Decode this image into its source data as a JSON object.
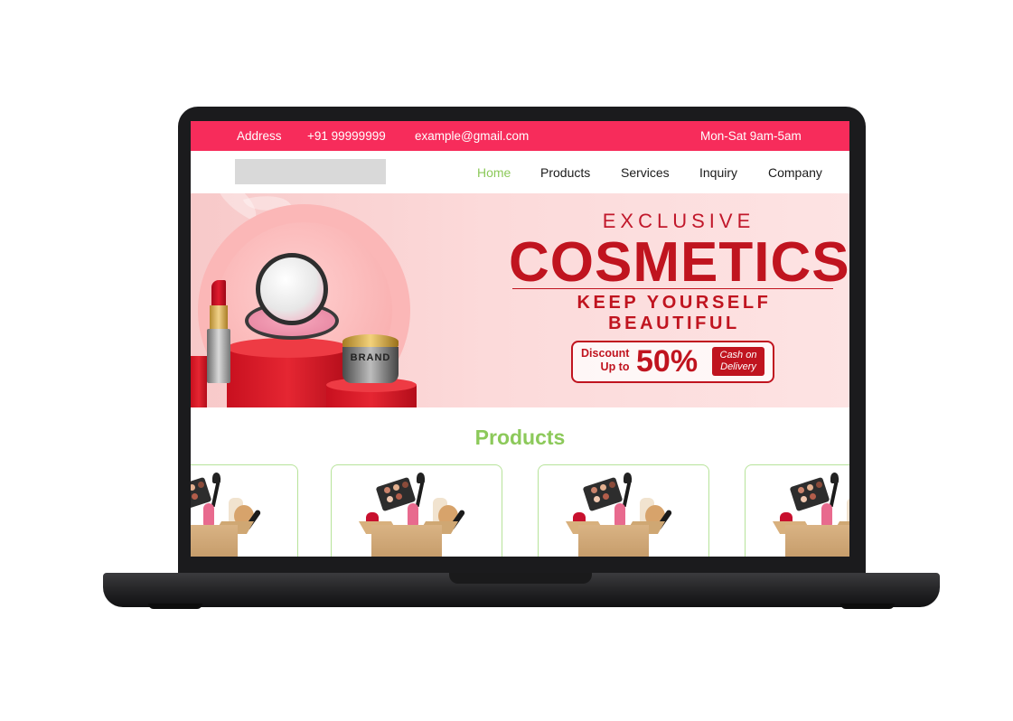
{
  "topbar": {
    "address": "Address",
    "phone": "+91 99999999",
    "email": "example@gmail.com",
    "hours": "Mon-Sat 9am-5am"
  },
  "nav": {
    "items": [
      {
        "label": "Home",
        "active": true
      },
      {
        "label": "Products",
        "active": false
      },
      {
        "label": "Services",
        "active": false
      },
      {
        "label": "Inquiry",
        "active": false
      },
      {
        "label": "Company",
        "active": false
      }
    ]
  },
  "banner": {
    "eyebrow": "EXCLUSIVE",
    "title": "COSMETICS",
    "tagline": "KEEP YOURSELF BEAUTIFUL",
    "discount_line1": "Discount",
    "discount_line2": "Up to",
    "discount_value": "50%",
    "cod_line1": "Cash on",
    "cod_line2": "Delivery",
    "jar_label": "BRAND"
  },
  "products": {
    "heading": "Products",
    "cards": [
      {
        "image": "cosmetics-box-image"
      },
      {
        "image": "cosmetics-box-image"
      },
      {
        "image": "cosmetics-box-image"
      },
      {
        "image": "cosmetics-box-image"
      }
    ]
  },
  "colors": {
    "topbar_bg": "#f72c5b",
    "accent_green": "#8cc95a",
    "banner_red": "#c0141f",
    "card_border": "#b7e39a"
  }
}
